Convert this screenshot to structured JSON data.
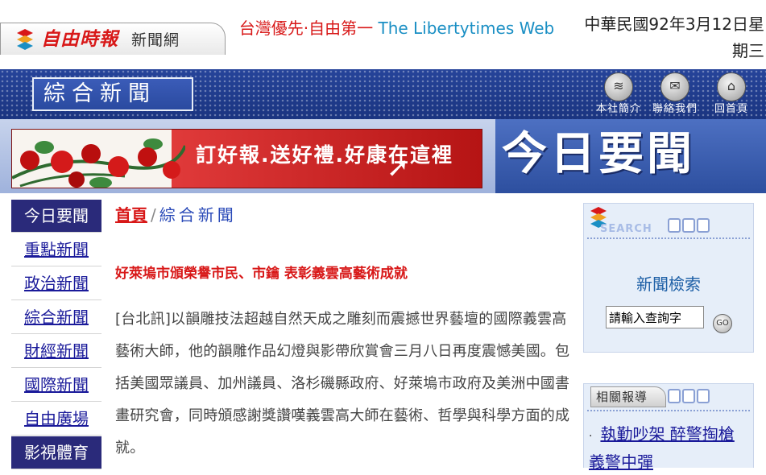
{
  "site": {
    "logo_name": "自由時報",
    "logo_suffix": "新聞網",
    "slogan_zh": "台灣優先·自由第一",
    "slogan_en": "The Libertytimes Web",
    "date_line1": "中華民國92年3月12日星",
    "date_line2": "期三"
  },
  "header": {
    "section_title": "綜合新聞",
    "nav": [
      {
        "label": "本社簡介",
        "icon": "stack-icon"
      },
      {
        "label": "聯絡我們",
        "icon": "mail-icon"
      },
      {
        "label": "回首頁",
        "icon": "home-icon"
      }
    ]
  },
  "banner": {
    "ad_text": "訂好報.送好禮.好康在這裡",
    "today_title": "今日要聞"
  },
  "left_nav": {
    "items": [
      {
        "label": "今日要聞"
      },
      {
        "label": "重點新聞"
      },
      {
        "label": "政治新聞"
      },
      {
        "label": "綜合新聞"
      },
      {
        "label": "財經新聞"
      },
      {
        "label": "國際新聞"
      },
      {
        "label": "自由廣場"
      },
      {
        "label": "影視體育"
      }
    ]
  },
  "article": {
    "breadcrumb_home": "首頁",
    "breadcrumb_sep": "/",
    "breadcrumb_section": "綜合新聞",
    "headline": "好萊塢市頒榮譽市民、市鑰 表彰義雲高藝術成就",
    "body": "[台北訊]以韻雕技法超越自然天成之雕刻而震撼世界藝壇的國際義雲高藝術大師，他的韻雕作品幻燈與影帶欣賞會三月八日再度震憾美國。包括美國眾議員、加州議員、洛杉磯縣政府、好萊塢市政府及美洲中國書畫研究會，同時頒感謝獎讚嘆義雲高大師在藝術、哲學與科學方面的成就。"
  },
  "sidebar": {
    "search_word": "SEARCH",
    "search_title": "新聞檢索",
    "search_value": "請輸入查詢字",
    "go_label": "GO",
    "related_tab": "相關報導",
    "related_links": [
      {
        "text": "執勤吵架 醉警掏槍 義警中彈"
      }
    ]
  },
  "colors": {
    "brand_red": "#d81818",
    "header_blue": "#1a3480",
    "nav_active": "#2a2a7a",
    "link_blue": "#1a1a9a",
    "sidebar_bg": "#e6eef9"
  }
}
